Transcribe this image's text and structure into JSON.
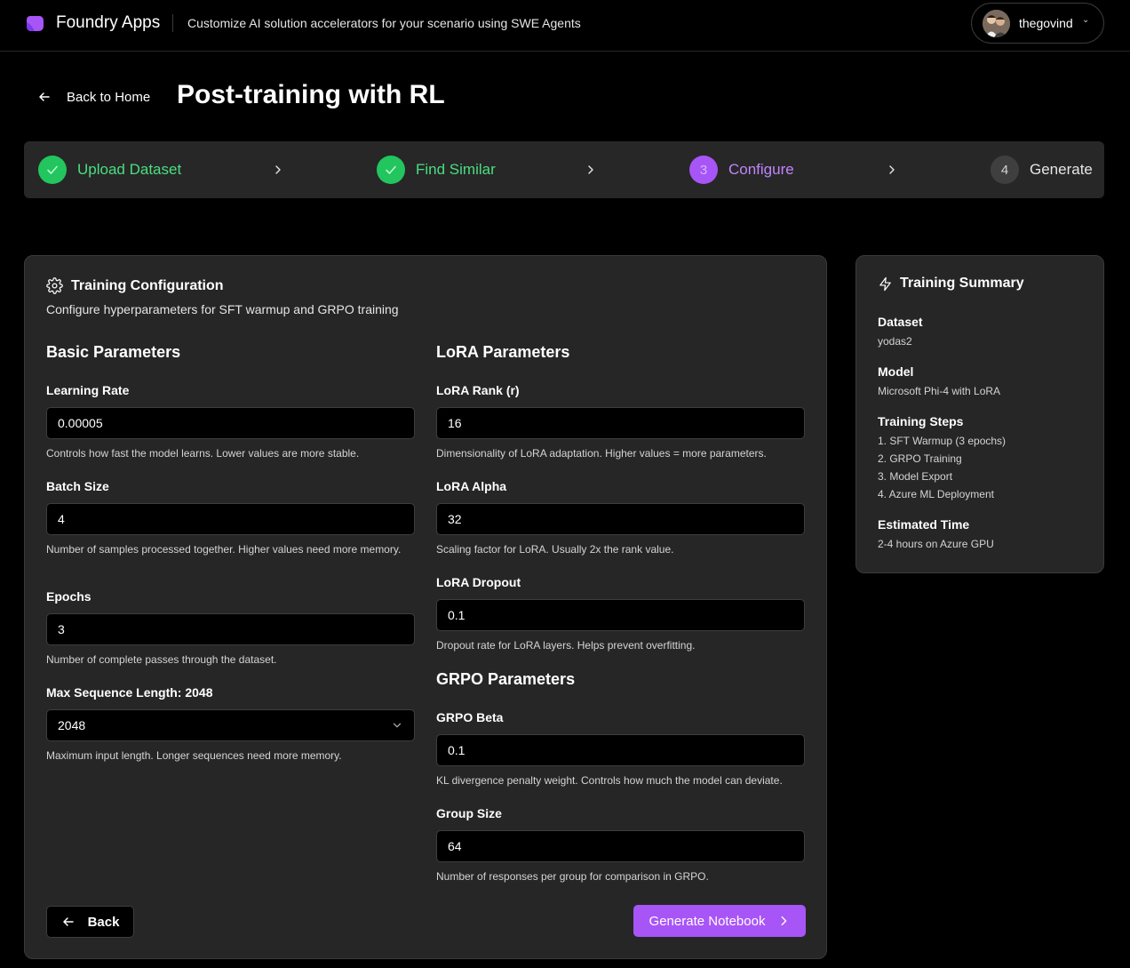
{
  "header": {
    "brand": "Foundry Apps",
    "tagline": "Customize AI solution accelerators for your scenario using SWE Agents",
    "username": "thegovind",
    "logo_color": "#a855f7"
  },
  "nav": {
    "back_label": "Back to Home"
  },
  "page": {
    "title": "Post-training with RL"
  },
  "steps": [
    {
      "label": "Upload Dataset",
      "status": "done",
      "number": "1"
    },
    {
      "label": "Find Similar",
      "status": "done",
      "number": "2"
    },
    {
      "label": "Configure",
      "status": "active",
      "number": "3"
    },
    {
      "label": "Generate",
      "status": "todo",
      "number": "4"
    }
  ],
  "config": {
    "title": "Training Configuration",
    "subtitle": "Configure hyperparameters for SFT warmup and GRPO training",
    "basic": {
      "title": "Basic Parameters",
      "learning_rate": {
        "label": "Learning Rate",
        "value": "0.00005",
        "help": "Controls how fast the model learns. Lower values are more stable."
      },
      "batch_size": {
        "label": "Batch Size",
        "value": "4",
        "help": "Number of samples processed together. Higher values need more memory."
      },
      "epochs": {
        "label": "Epochs",
        "value": "3",
        "help": "Number of complete passes through the dataset."
      },
      "max_seq": {
        "label": "Max Sequence Length: 2048",
        "value": "2048",
        "help": "Maximum input length. Longer sequences need more memory."
      }
    },
    "lora": {
      "title": "LoRA Parameters",
      "rank": {
        "label": "LoRA Rank (r)",
        "value": "16",
        "help": "Dimensionality of LoRA adaptation. Higher values = more parameters."
      },
      "alpha": {
        "label": "LoRA Alpha",
        "value": "32",
        "help": "Scaling factor for LoRA. Usually 2x the rank value."
      },
      "dropout": {
        "label": "LoRA Dropout",
        "value": "0.1",
        "help": "Dropout rate for LoRA layers. Helps prevent overfitting."
      }
    },
    "grpo": {
      "title": "GRPO Parameters",
      "beta": {
        "label": "GRPO Beta",
        "value": "0.1",
        "help": "KL divergence penalty weight. Controls how much the model can deviate."
      },
      "group_size": {
        "label": "Group Size",
        "value": "64",
        "help": "Number of responses per group for comparison in GRPO."
      }
    },
    "back_button": "Back",
    "generate_button": "Generate Notebook"
  },
  "summary": {
    "title": "Training Summary",
    "dataset_label": "Dataset",
    "dataset_value": "yodas2",
    "model_label": "Model",
    "model_value": "Microsoft Phi-4 with LoRA",
    "steps_label": "Training Steps",
    "steps": [
      "1. SFT Warmup (3 epochs)",
      "2. GRPO Training",
      "3. Model Export",
      "4. Azure ML Deployment"
    ],
    "time_label": "Estimated Time",
    "time_value": "2-4 hours on Azure GPU"
  },
  "colors": {
    "success": "#22c55e",
    "accent": "#a855f7",
    "card_bg": "#262626"
  }
}
